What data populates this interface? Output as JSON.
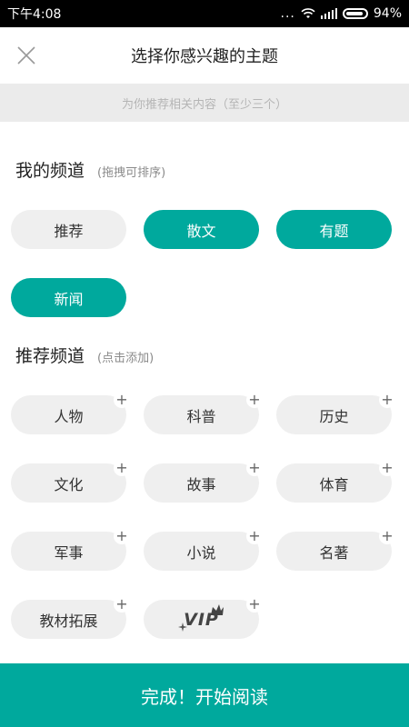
{
  "status": {
    "time": "下午4:08",
    "dots": "...",
    "battery": "94%"
  },
  "header": {
    "title": "选择你感兴趣的主题",
    "close_icon": "close-icon"
  },
  "hint": "为你推荐相关内容（至少三个）",
  "my_channels": {
    "title": "我的频道",
    "subtitle": "(拖拽可排序)",
    "items": [
      {
        "label": "推荐",
        "selected": false
      },
      {
        "label": "散文",
        "selected": true
      },
      {
        "label": "有题",
        "selected": true
      },
      {
        "label": "新闻",
        "selected": true
      }
    ]
  },
  "recommended": {
    "title": "推荐频道",
    "subtitle": "(点击添加)",
    "add_symbol": "+",
    "items": [
      {
        "label": "人物"
      },
      {
        "label": "科普"
      },
      {
        "label": "历史"
      },
      {
        "label": "文化"
      },
      {
        "label": "故事"
      },
      {
        "label": "体育"
      },
      {
        "label": "军事"
      },
      {
        "label": "小说"
      },
      {
        "label": "名著"
      },
      {
        "label": "教材拓展"
      },
      {
        "label": "VIP"
      }
    ]
  },
  "done_button": "完成！开始阅读",
  "colors": {
    "accent": "#00a99d",
    "chip_gray": "#efefef",
    "hint_bg": "#ebebeb"
  }
}
